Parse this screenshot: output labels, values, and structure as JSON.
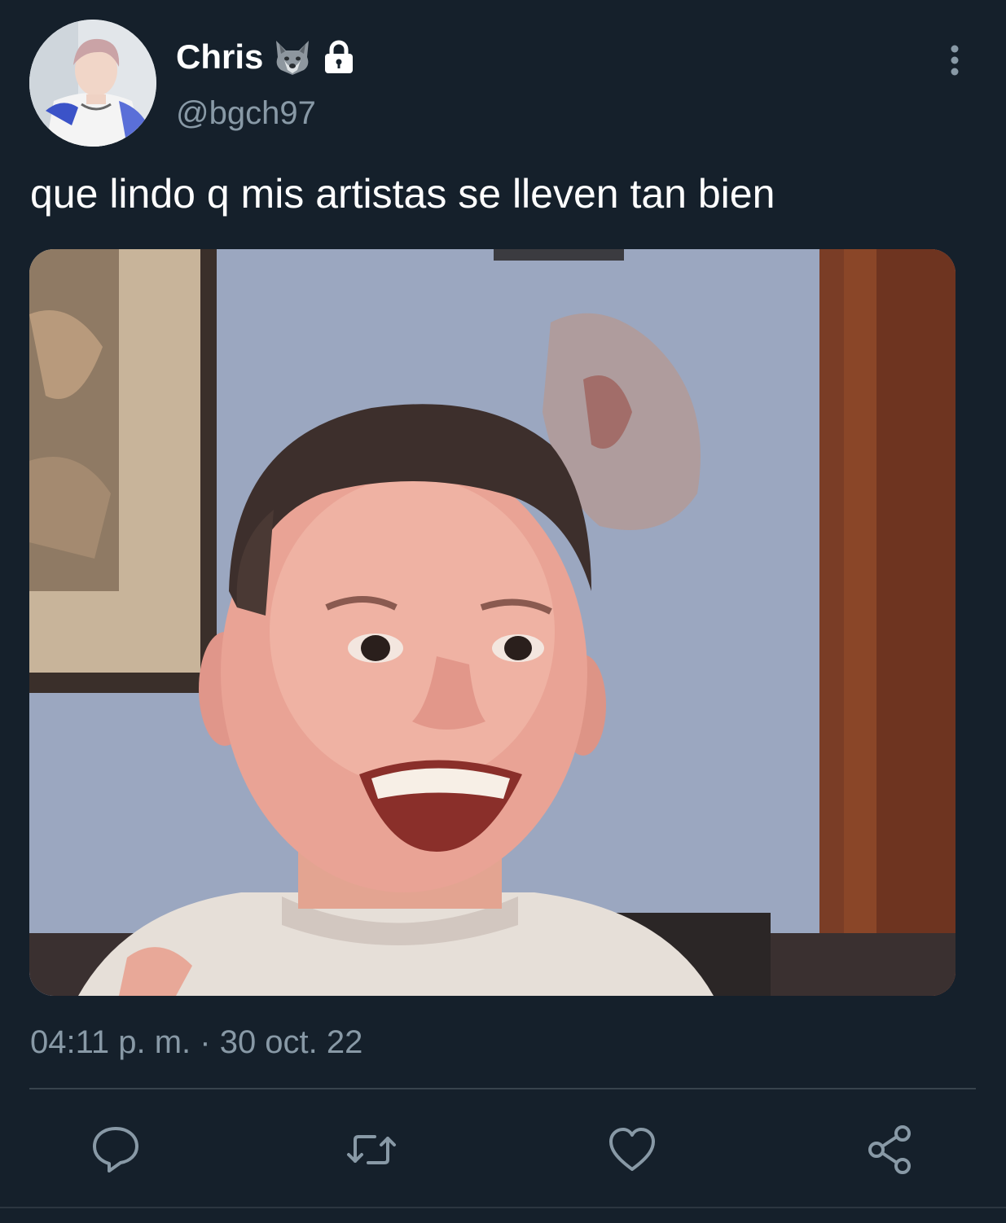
{
  "tweet": {
    "display_name": "Chris",
    "handle": "@bgch97",
    "text": "que lindo q mis artistas se lleven tan bien",
    "timestamp": "04:11 p. m. · 30 oct. 22",
    "badges": [
      "wolf-emoji",
      "lock-icon"
    ]
  },
  "actions": [
    {
      "name": "reply-icon"
    },
    {
      "name": "retweet-icon"
    },
    {
      "name": "like-icon"
    },
    {
      "name": "share-icon"
    }
  ],
  "colors": {
    "background": "#15202b",
    "primary_text": "#ffffff",
    "secondary_text": "#8899a6",
    "divider": "#38444d"
  }
}
